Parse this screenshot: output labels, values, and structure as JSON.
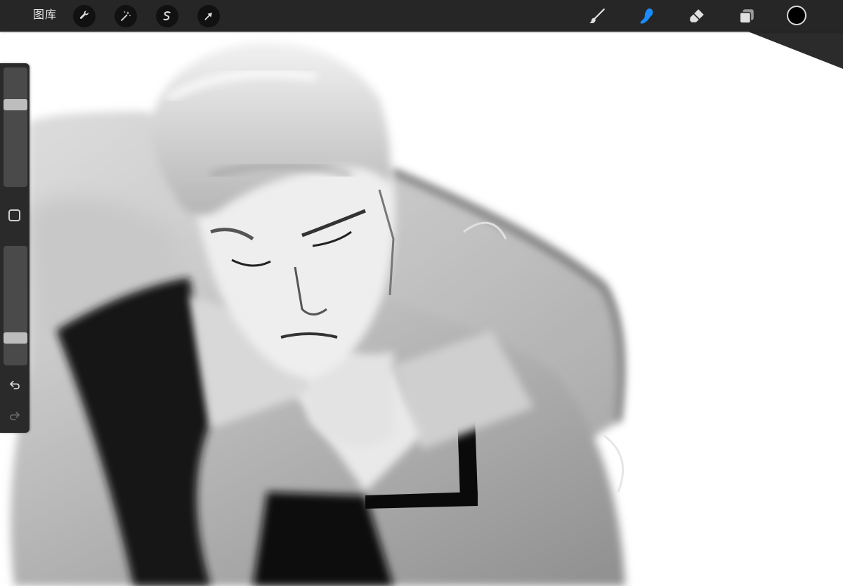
{
  "toolbar": {
    "gallery_label": "图库",
    "actions": [
      {
        "name": "actions-button",
        "icon": "wrench-icon"
      },
      {
        "name": "adjustments-button",
        "icon": "magic-wand-icon"
      },
      {
        "name": "selection-button",
        "icon": "selection-s-icon"
      },
      {
        "name": "transform-button",
        "icon": "arrow-cursor-icon"
      }
    ],
    "tools": [
      {
        "name": "brush-tool",
        "icon": "brush-icon",
        "active": false
      },
      {
        "name": "smudge-tool",
        "icon": "smudge-finger-icon",
        "active": true
      },
      {
        "name": "eraser-tool",
        "icon": "eraser-icon",
        "active": false
      },
      {
        "name": "layers-tool",
        "icon": "layers-icon",
        "active": false
      }
    ],
    "current_color": "#000000"
  },
  "sidebar": {
    "brush_size_level": 0.69,
    "brush_opacity_level": 0.23,
    "icons": [
      "square-modify-icon",
      "undo-icon",
      "redo-icon"
    ]
  },
  "colors": {
    "toolbar_bg": "#262626",
    "button_bg": "#111111",
    "accent_active": "#1a8cff",
    "icon_default": "#e0e0e0",
    "canvas_bg": "#ffffff"
  }
}
